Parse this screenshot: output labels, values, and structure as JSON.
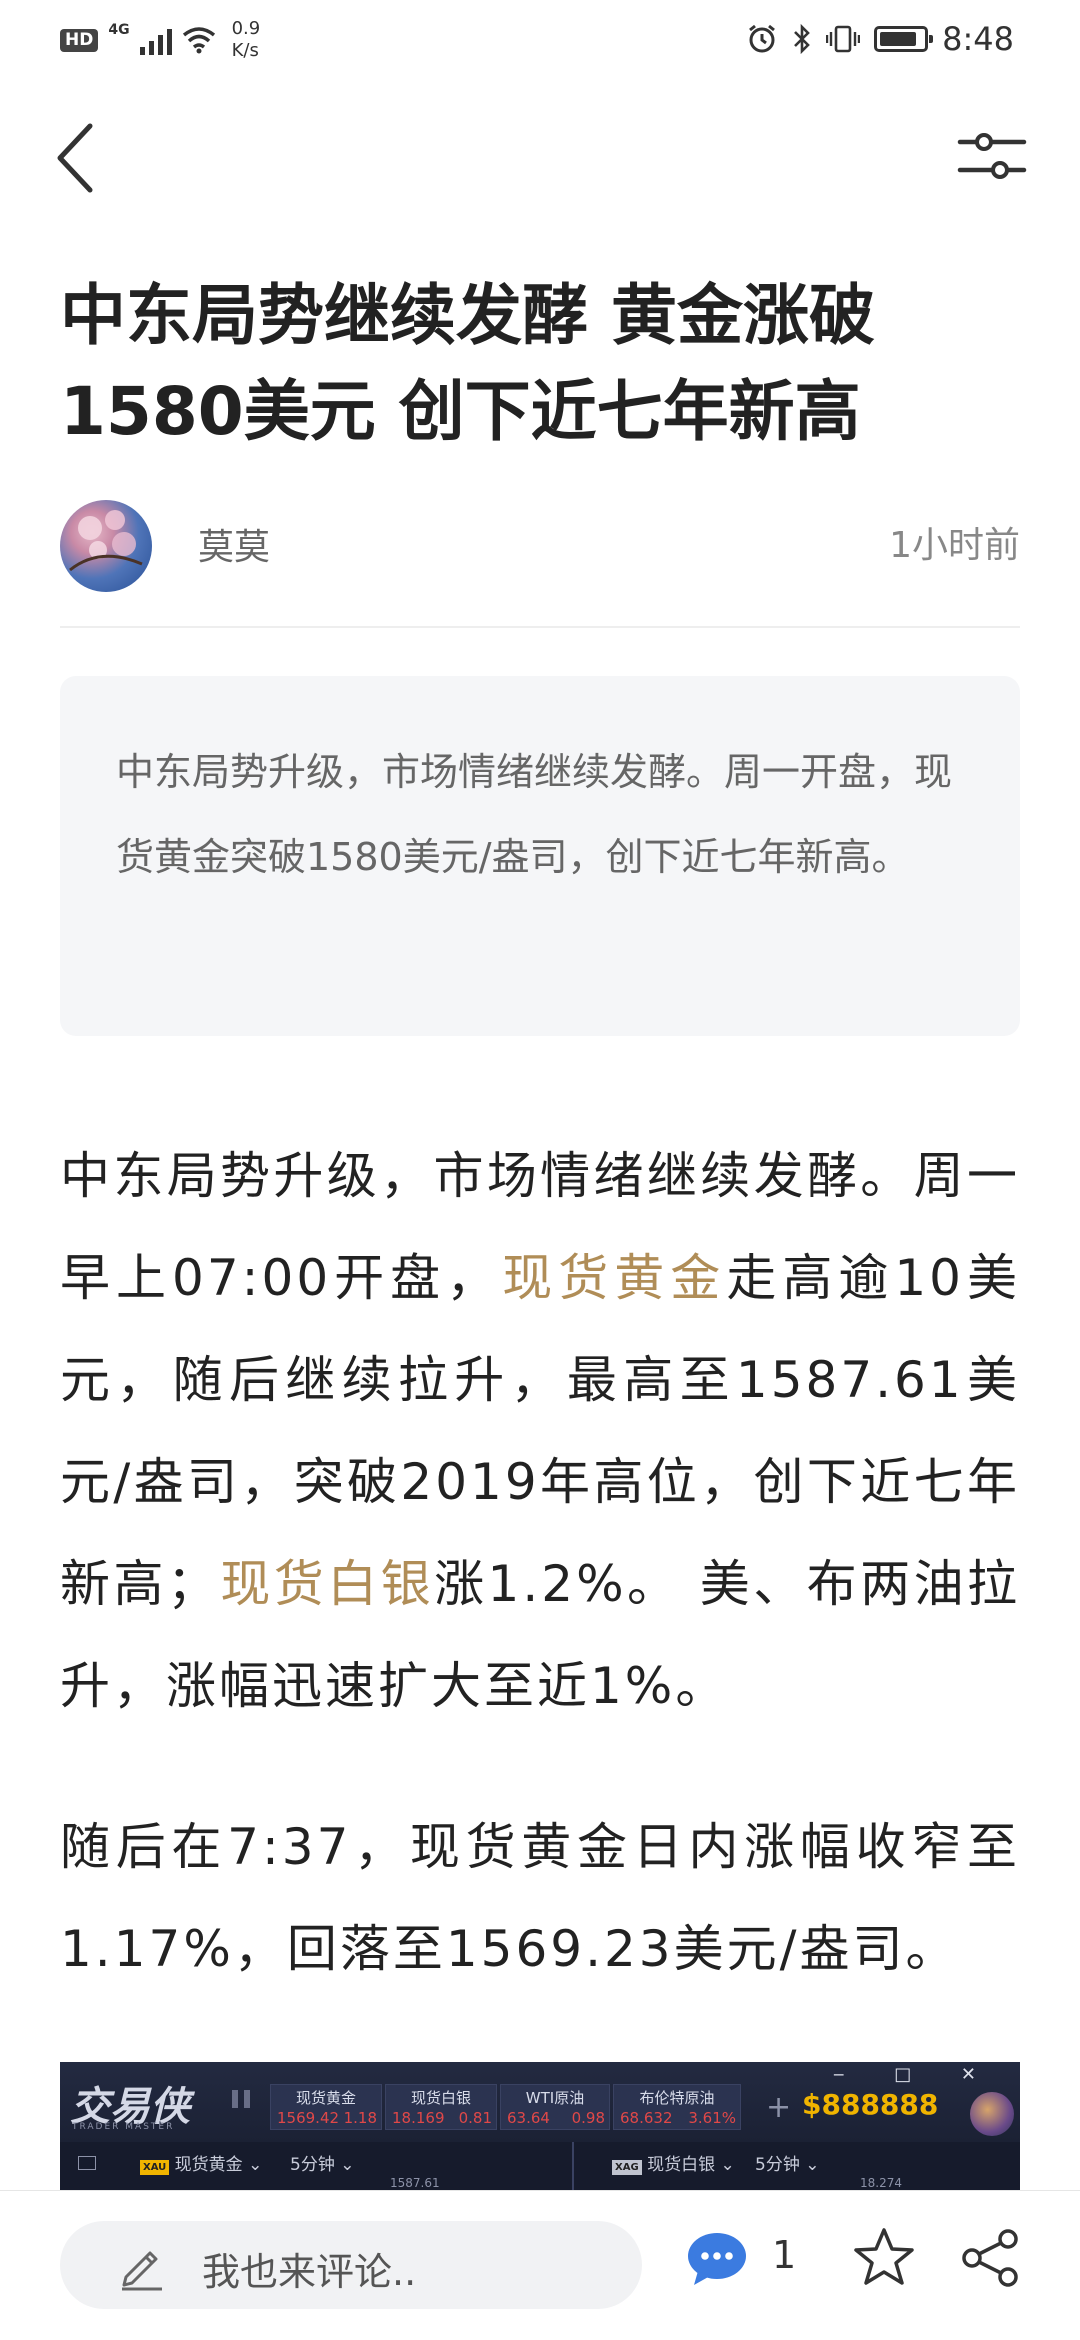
{
  "status_bar": {
    "hd_badge": "HD",
    "network_type": "4G",
    "net_speed_value": "0.9",
    "net_speed_unit": "K/s",
    "battery_level": 0.85,
    "time": "8:48"
  },
  "nav": {
    "back_icon": "chevron-left-icon",
    "settings_icon": "sliders-icon"
  },
  "article": {
    "title_line1": "中东局势继续发酵 黄金涨破",
    "title_line2": "1580美元 创下近七年新高",
    "author": "莫莫",
    "time_ago": "1小时前",
    "summary": "中东局势升级，市场情绪继续发酵。周一开盘，现货黄金突破1580美元/盎司，创下近七年新高。",
    "p1_a": "中东局势升级，市场情绪继续发酵。周一早上07:00开盘，",
    "p1_link1": "现货黄金",
    "p1_b": "走高逾10美元，随后继续拉升，最高至1587.61美元/盎司，突破2019年高位，创下近七年新高；",
    "p1_link2": "现货白银",
    "p1_c": "涨1.2%。 美、布两油拉升，涨幅迅速扩大至近1%。",
    "p2": "随后在7:37，现货黄金日内涨幅收窄至1.17%，回落至1569.23美元/盎司。",
    "link_color": "#b08d57"
  },
  "embedded_image": {
    "logo": "交易侠",
    "logo_sub": "TRADER MASTER",
    "tabs": [
      {
        "name": "现货黄金",
        "price": "1569.42",
        "change": "1.18"
      },
      {
        "name": "现货白银",
        "price": "18.169",
        "change": "0.81"
      },
      {
        "name": "WTI原油",
        "price": "63.64",
        "change": "0.98"
      },
      {
        "name": "布伦特原油",
        "price": "68.632",
        "change": "3.61%"
      }
    ],
    "plus": "+",
    "balance": "$888888",
    "window_controls": "‒ □ ✕",
    "left_symbol": "XAU",
    "left_name": "现货黄金 ⌄",
    "left_period": "5分钟 ⌄",
    "left_price": "1587.61",
    "right_symbol": "XAG",
    "right_name": "现货白银 ⌄",
    "right_period": "5分钟 ⌄",
    "right_price": "18.274"
  },
  "bottom_bar": {
    "comment_placeholder": "我也来评论..",
    "comment_count": "1",
    "icons": [
      "pencil-icon",
      "comment-bubble-icon",
      "star-icon",
      "share-icon"
    ]
  }
}
